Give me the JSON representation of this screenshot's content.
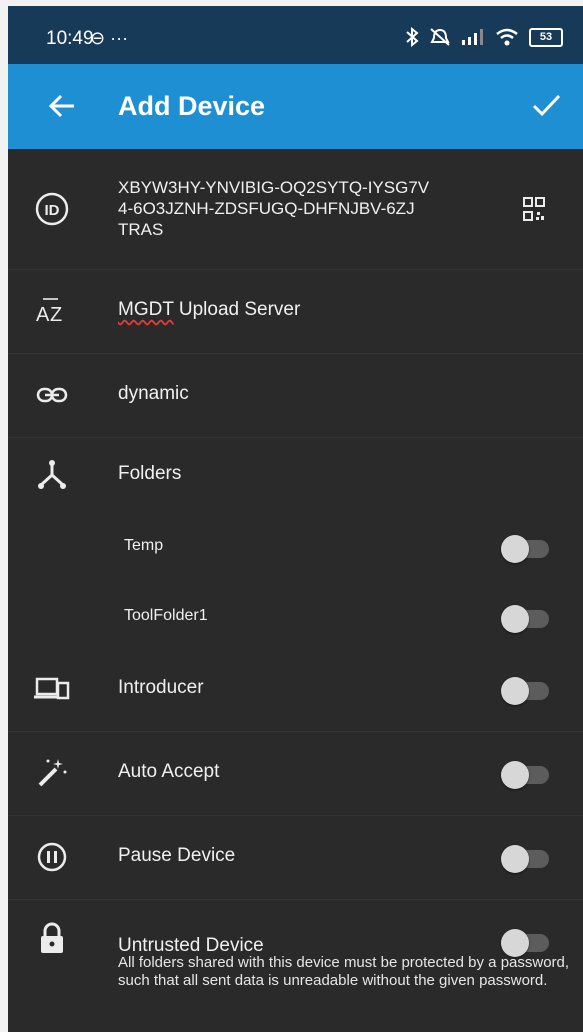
{
  "status_bar": {
    "time": "10:49",
    "left_icons": "⊖ ···",
    "battery": "53"
  },
  "app_bar": {
    "title": "Add Device"
  },
  "device_id": {
    "text": "XBYW3HY-YNVIBIG-OQ2SYTQ-IYSG7V\n4-6O3JZNH-ZDSFUGQ-DHFNJBV-6ZJ\nTRAS"
  },
  "device_name": {
    "first_word": "MGDT",
    "rest": " Upload Server"
  },
  "address": {
    "value": "dynamic"
  },
  "folders": {
    "label": "Folders",
    "items": [
      {
        "name": "Temp",
        "enabled": false
      },
      {
        "name": "ToolFolder1",
        "enabled": false
      }
    ]
  },
  "options": {
    "introducer": {
      "label": "Introducer",
      "enabled": false
    },
    "auto_accept": {
      "label": "Auto Accept",
      "enabled": false
    },
    "pause_device": {
      "label": "Pause Device",
      "enabled": false
    },
    "untrusted": {
      "label": "Untrusted Device",
      "enabled": false,
      "description": "All folders shared with this device must be protected by a password, such that all sent data is unreadable without the given password."
    }
  },
  "colors": {
    "app_bar": "#1f8fd3",
    "status_bar": "#173a59",
    "background": "#2a2a2a"
  }
}
